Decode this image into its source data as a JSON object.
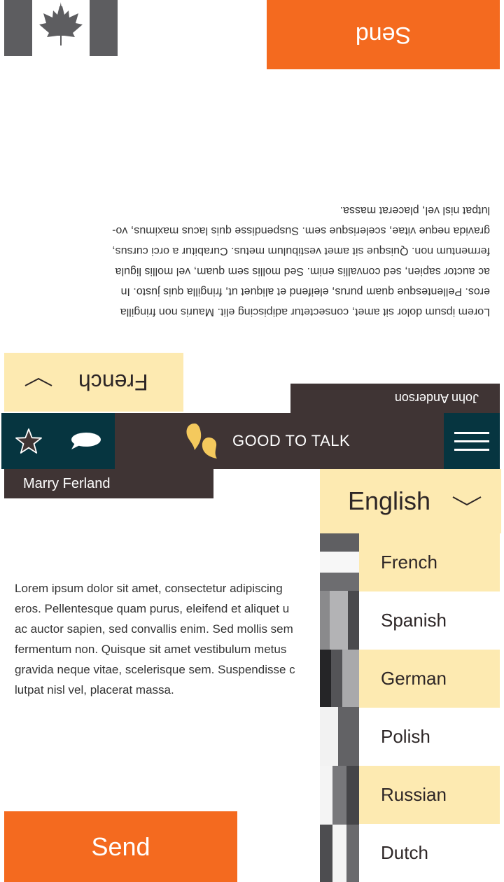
{
  "colors": {
    "accent_orange": "#f46a1f",
    "dark_brown": "#3f3434",
    "dark_teal": "#063540",
    "pale_yellow": "#fdeab1",
    "logo_yellow": "#f4c95d"
  },
  "icons": {
    "flag": "maple-leaf-flag-icon",
    "favorite": "star-icon",
    "chat": "chat-bubble-icon",
    "logo": "quote-bubble-logo-icon",
    "menu": "hamburger-menu-icon",
    "chevron": "chevron-down-icon"
  },
  "top_panel": {
    "send_label": "Send",
    "paragraph_lines": [
      "Lorem ipsum dolor sit amet, consectetur adipiscing elit. Mauris non fringilla",
      "eros. Pellentesque quam purus, eleifend et aliquet ut, fringilla quis justo. In",
      "ac auctor sapien, sed convallis enim. Sed mollis sem quam, vel mollis ligula",
      "fermentum non. Quisque sit amet vestibulum metus. Curabitur a orci cursus,",
      "gravida neque vitae, scelerisque sem. Suspendisse quis lacus maximus, vo-",
      "lutpat nisl vel, placerat massa."
    ],
    "language": "French",
    "user_name": "John Anderson"
  },
  "header": {
    "title": "GOOD TO TALK"
  },
  "bottom_panel": {
    "user_name": "Marry Ferland",
    "paragraph_lines": [
      "Lorem ipsum dolor sit amet, consectetur adipiscing",
      "eros. Pellentesque quam purus, eleifend et aliquet u",
      "ac auctor sapien, sed convallis enim. Sed mollis sem",
      "fermentum non. Quisque sit amet vestibulum metus",
      "gravida neque vitae, scelerisque sem. Suspendisse c",
      "lutpat nisl vel, placerat massa."
    ],
    "send_label": "Send"
  },
  "language_dropdown": {
    "selected": "English",
    "options": [
      "French",
      "Spanish",
      "German",
      "Polish",
      "Russian",
      "Dutch"
    ]
  }
}
